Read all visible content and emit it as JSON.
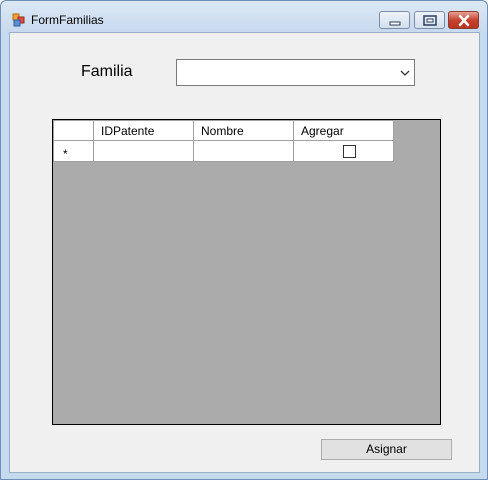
{
  "window": {
    "title": "FormFamilias"
  },
  "form": {
    "familia_label": "Familia",
    "familia_selected": ""
  },
  "grid": {
    "columns": [
      "IDPatente",
      "Nombre",
      "Agregar"
    ],
    "new_row": {
      "marker": "*",
      "IDPatente": "",
      "Nombre": "",
      "Agregar": false
    }
  },
  "buttons": {
    "assign_label": "Asignar"
  }
}
